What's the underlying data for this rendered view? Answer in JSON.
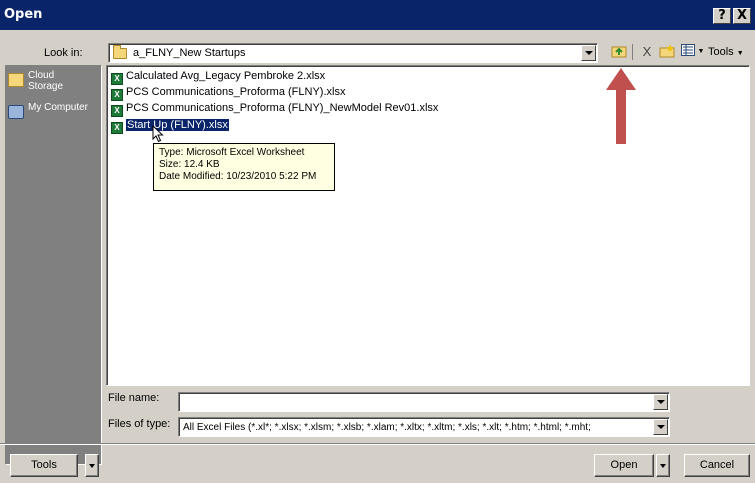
{
  "window": {
    "title": "Open",
    "help_label": "?",
    "close_label": "X"
  },
  "look_in": {
    "label": "Look in:",
    "value": "a_FLNY_New Startups"
  },
  "toolbar": {
    "icons": [
      "up-folder-icon",
      "delete-icon",
      "new-folder-icon",
      "views-icon"
    ],
    "tools_label": "Tools",
    "delete_glyph": "X"
  },
  "places": [
    {
      "name": "Cloud Storage",
      "icon": "cloud-storage-folder-icon"
    },
    {
      "name": "My Computer",
      "icon": "my-computer-icon"
    }
  ],
  "files": [
    {
      "name": "Calculated Avg_Legacy Pembroke 2.xlsx",
      "selected": false
    },
    {
      "name": "PCS Communications_Proforma (FLNY).xlsx",
      "selected": false
    },
    {
      "name": "PCS Communications_Proforma (FLNY)_NewModel Rev01.xlsx",
      "selected": false
    },
    {
      "name": "Start Up (FLNY).xlsx",
      "selected": true
    }
  ],
  "tooltip": {
    "type": "Type: Microsoft Excel Worksheet",
    "size": "Size: 12.4 KB",
    "modified": "Date Modified: 10/23/2010 5:22 PM"
  },
  "file_name": {
    "label": "File name:",
    "value": ""
  },
  "files_of_type": {
    "label": "Files of type:",
    "value": "All Excel Files (*.xl*; *.xlsx; *.xlsm; *.xlsb; *.xlam; *.xltx; *.xltm; *.xls; *.xlt; *.htm; *.html; *.mht;"
  },
  "buttons": {
    "tools": "Tools",
    "open": "Open",
    "cancel": "Cancel"
  },
  "colors": {
    "title_bar": "#0a246a",
    "selection": "#0a246a",
    "annotation_arrow": "#c0504d"
  }
}
